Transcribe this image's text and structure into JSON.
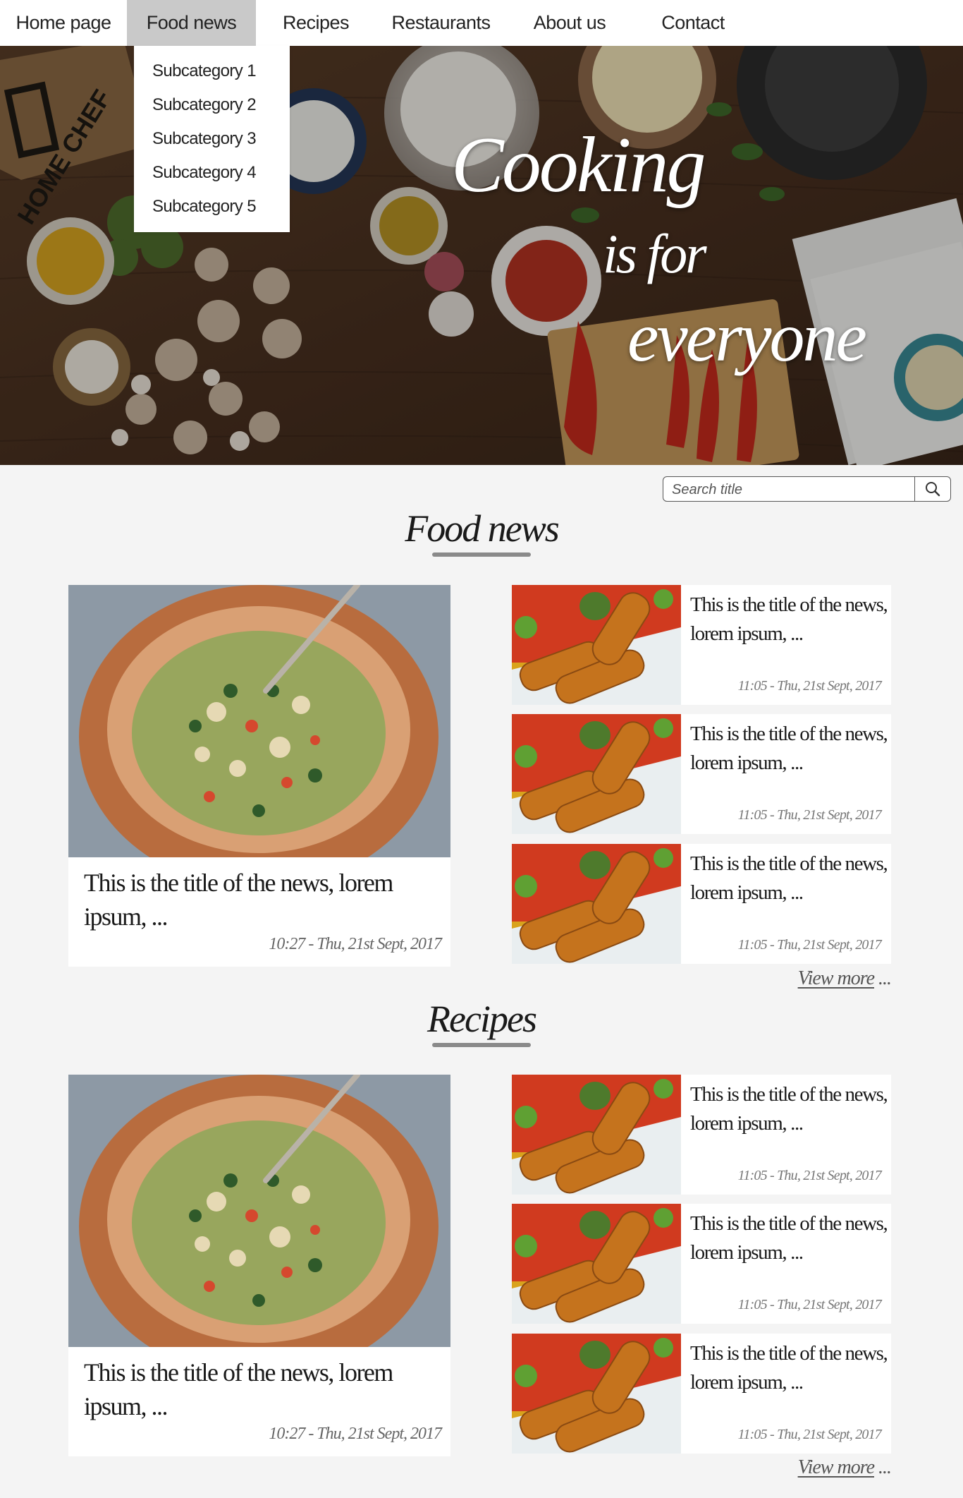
{
  "nav": {
    "items": [
      {
        "label": "Home page"
      },
      {
        "label": "Food news",
        "active": true
      },
      {
        "label": "Recipes"
      },
      {
        "label": "Restaurants"
      },
      {
        "label": "About us"
      },
      {
        "label": "Contact"
      }
    ],
    "dropdown": [
      "Subcategory 1",
      "Subcategory 2",
      "Subcategory 3",
      "Subcategory 4",
      "Subcategory 5"
    ]
  },
  "hero": {
    "line1": "Cooking",
    "line2": "is for",
    "line3": "everyone",
    "box_text": "HOME CHEF"
  },
  "search": {
    "placeholder": "Search title"
  },
  "sections": [
    {
      "title": "Food news",
      "featured": {
        "title": "This is the title of the news, lorem ipsum, ...",
        "date": "10:27 - Thu, 21st Sept, 2017"
      },
      "items": [
        {
          "title": "This is the title of the news, lorem ipsum, ...",
          "date": "11:05 - Thu, 21st Sept, 2017"
        },
        {
          "title": "This is the title of the news, lorem ipsum, ...",
          "date": "11:05 - Thu, 21st Sept, 2017"
        },
        {
          "title": "This is the title of the news, lorem ipsum, ...",
          "date": "11:05 - Thu, 21st Sept, 2017"
        }
      ],
      "view_more": "View more",
      "ellipsis": "..."
    },
    {
      "title": "Recipes",
      "featured": {
        "title": "This is the title of the news, lorem ipsum, ...",
        "date": "10:27 - Thu, 21st Sept, 2017"
      },
      "items": [
        {
          "title": "This is the title of the news, lorem ipsum, ...",
          "date": "11:05 - Thu, 21st Sept, 2017"
        },
        {
          "title": "This is the title of the news, lorem ipsum, ...",
          "date": "11:05 - Thu, 21st Sept, 2017"
        },
        {
          "title": "This is the title of the news, lorem ipsum, ...",
          "date": "11:05 - Thu, 21st Sept, 2017"
        }
      ],
      "view_more": "View more",
      "ellipsis": "..."
    }
  ],
  "colors": {
    "background": "#f4f4f4",
    "nav_active": "#c9c9c9",
    "underline": "#8a8a8a",
    "hero_wood": "#4b3322"
  },
  "icons": {
    "search": "magnifier-icon"
  }
}
